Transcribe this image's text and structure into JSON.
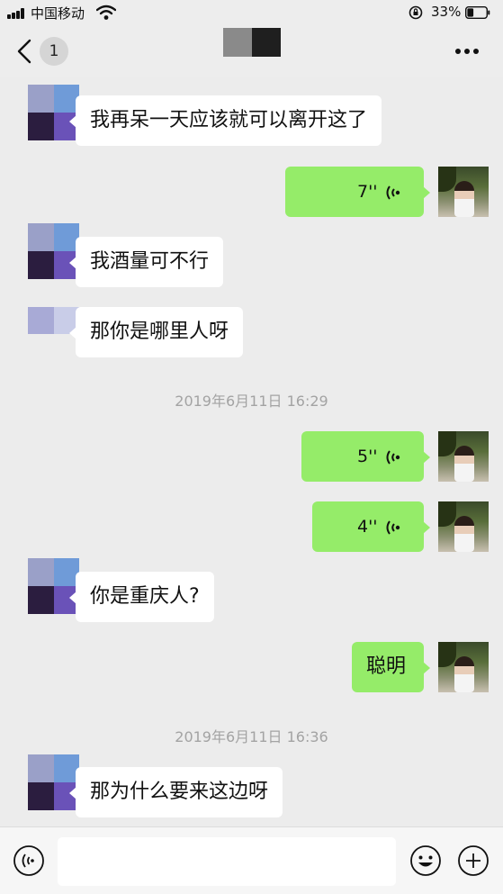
{
  "status_bar": {
    "carrier": "中国移动",
    "battery_percent": "33%",
    "battery_level": 0.33,
    "icons": [
      "signal-icon",
      "wifi-icon",
      "rotation-lock-icon",
      "battery-icon"
    ]
  },
  "nav": {
    "unread_count": "1",
    "icons": [
      "chevron-left-icon",
      "more-horizontal-icon"
    ]
  },
  "messages": [
    {
      "type": "text",
      "side": "in",
      "text": "我再呆一天应该就可以离开这了"
    },
    {
      "type": "voice",
      "side": "out",
      "duration": "7''"
    },
    {
      "type": "text",
      "side": "in",
      "text": "我酒量可不行"
    },
    {
      "type": "text",
      "side": "in",
      "text": "那你是哪里人呀"
    },
    {
      "type": "timestamp",
      "text": "2019年6月11日 16:29"
    },
    {
      "type": "voice",
      "side": "out",
      "duration": "5''"
    },
    {
      "type": "voice",
      "side": "out",
      "duration": "4''"
    },
    {
      "type": "text",
      "side": "in",
      "text": "你是重庆人?"
    },
    {
      "type": "text",
      "side": "out",
      "text": "聪明"
    },
    {
      "type": "timestamp",
      "text": "2019年6月11日 16:36"
    },
    {
      "type": "text",
      "side": "in",
      "text": "那为什么要来这边呀"
    }
  ],
  "input_bar": {
    "placeholder": "",
    "icons": [
      "voice-input-icon",
      "emoji-icon",
      "plus-icon"
    ]
  },
  "colors": {
    "background": "#ececec",
    "outgoing_bubble": "#95ec69",
    "incoming_bubble": "#ffffff",
    "timestamp_text": "#a3a3a3"
  }
}
